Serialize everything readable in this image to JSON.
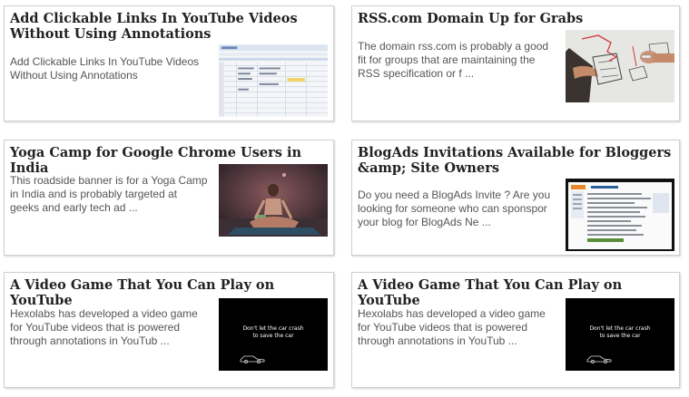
{
  "posts": [
    {
      "title": "Add Clickable Links In YouTube Videos Without Using Annotations",
      "excerpt": "Add Clickable Links In YouTube Videos Without Using Annotations",
      "thumb_icon": "spreadsheet-screenshot-icon"
    },
    {
      "title": "RSS.com Domain Up for Grabs",
      "excerpt": "The domain rss.com is probably a good fit for groups that are maintaining the RSS specification or f ...",
      "thumb_icon": "whiteboard-drawing-icon"
    },
    {
      "title": "Yoga Camp for Google Chrome Users in India",
      "excerpt": "This roadside banner is for a Yoga Camp in India and is probably targeted at geeks and early tech ad ...",
      "thumb_icon": "yoga-photo-icon"
    },
    {
      "title": "BlogAds Invitations Available for Bloggers &amp; Site Owners",
      "excerpt": "Do you need a BlogAds Invite ? Are you looking for someone who can sponspor your blog for BlogAds Ne ...",
      "thumb_icon": "blogads-screenshot-icon"
    },
    {
      "title": "A Video Game That You Can Play on YouTube",
      "excerpt": "Hexolabs has developed a video game for YouTube videos that is powered through annotations in YouTub ...",
      "thumb_icon": "video-game-frame-icon",
      "thumb_caption": "Don't let the car crash\nto save the car"
    },
    {
      "title": "A Video Game That You Can Play on YouTube",
      "excerpt": "Hexolabs has developed a video game for YouTube videos that is powered through annotations in YouTub ...",
      "thumb_icon": "video-game-frame-icon",
      "thumb_caption": "Don't let the car crash\nto save the car"
    }
  ]
}
